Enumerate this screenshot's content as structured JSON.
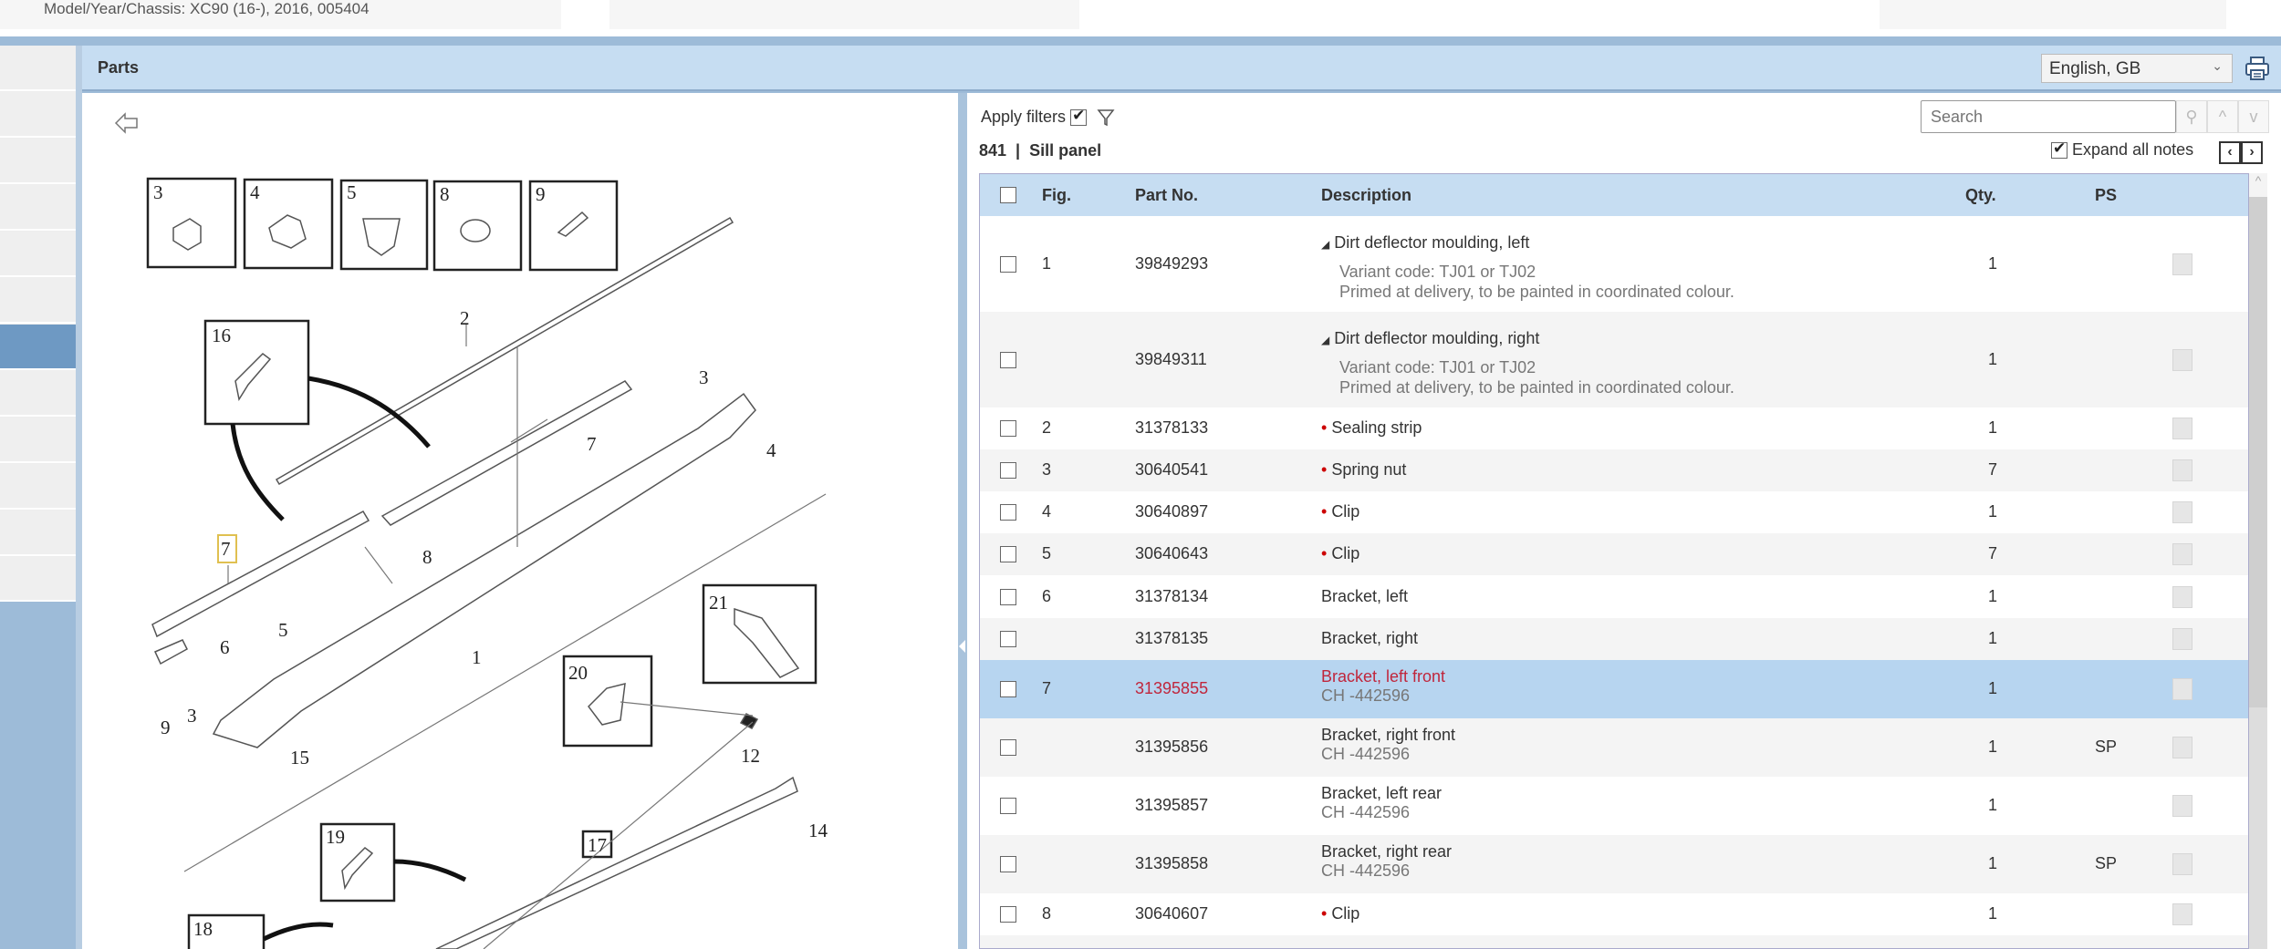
{
  "header": {
    "model_info": "Model/Year/Chassis: XC90 (16-), 2016, 005404",
    "panel_title": "Parts",
    "language": "English, GB"
  },
  "toolbar": {
    "apply_filters": "Apply filters",
    "apply_filters_checked": true,
    "search_placeholder": "Search",
    "expand_all_notes": "Expand all notes",
    "expand_checked": true,
    "prev": "‹",
    "next": "›"
  },
  "catalog": {
    "label": "841  |  Sill panel"
  },
  "table": {
    "headers": {
      "fig": "Fig.",
      "part_no": "Part No.",
      "description": "Description",
      "qty": "Qty.",
      "ps": "PS"
    },
    "rows": [
      {
        "fig": "1",
        "part_no": "39849293",
        "description": "Dirt deflector moulding, left",
        "expandable": true,
        "notes": [
          "Variant code: TJ01 or TJ02",
          "Primed at delivery, to be painted in coordinated colour."
        ],
        "qty": "1",
        "ps": ""
      },
      {
        "fig": "",
        "part_no": "39849311",
        "description": "Dirt deflector moulding, right",
        "expandable": true,
        "notes": [
          "Variant code: TJ01 or TJ02",
          "Primed at delivery, to be painted in coordinated colour."
        ],
        "qty": "1",
        "ps": ""
      },
      {
        "fig": "2",
        "part_no": "31378133",
        "description": "Sealing strip",
        "bullet": true,
        "qty": "1",
        "ps": ""
      },
      {
        "fig": "3",
        "part_no": "30640541",
        "description": "Spring nut",
        "bullet": true,
        "qty": "7",
        "ps": ""
      },
      {
        "fig": "4",
        "part_no": "30640897",
        "description": "Clip",
        "bullet": true,
        "qty": "1",
        "ps": ""
      },
      {
        "fig": "5",
        "part_no": "30640643",
        "description": "Clip",
        "bullet": true,
        "qty": "7",
        "ps": ""
      },
      {
        "fig": "6",
        "part_no": "31378134",
        "description": "Bracket, left",
        "qty": "1",
        "ps": ""
      },
      {
        "fig": "",
        "part_no": "31378135",
        "description": "Bracket, right",
        "qty": "1",
        "ps": ""
      },
      {
        "fig": "7",
        "part_no": "31395855",
        "description": "Bracket, left front",
        "notes": [
          "CH -442596"
        ],
        "qty": "1",
        "ps": "",
        "selected": true
      },
      {
        "fig": "",
        "part_no": "31395856",
        "description": "Bracket, right front",
        "notes": [
          "CH -442596"
        ],
        "qty": "1",
        "ps": "SP"
      },
      {
        "fig": "",
        "part_no": "31395857",
        "description": "Bracket, left rear",
        "notes": [
          "CH -442596"
        ],
        "qty": "1",
        "ps": ""
      },
      {
        "fig": "",
        "part_no": "31395858",
        "description": "Bracket, right rear",
        "notes": [
          "CH -442596"
        ],
        "qty": "1",
        "ps": "SP"
      },
      {
        "fig": "8",
        "part_no": "30640607",
        "description": "Clip",
        "bullet": true,
        "qty": "1",
        "ps": ""
      }
    ]
  },
  "diagram": {
    "callouts": [
      "3",
      "4",
      "5",
      "8",
      "9",
      "16",
      "2",
      "3",
      "4",
      "7",
      "8",
      "7",
      "5",
      "6",
      "1",
      "9",
      "3",
      "15",
      "21",
      "20",
      "12",
      "14",
      "17",
      "19",
      "18"
    ],
    "highlighted_callout": "7"
  },
  "colors": {
    "accent": "#c6ddf2",
    "selected_row": "#b7d5f0",
    "selected_text": "#c0263c",
    "sidebar_selected": "#6e99c3"
  }
}
